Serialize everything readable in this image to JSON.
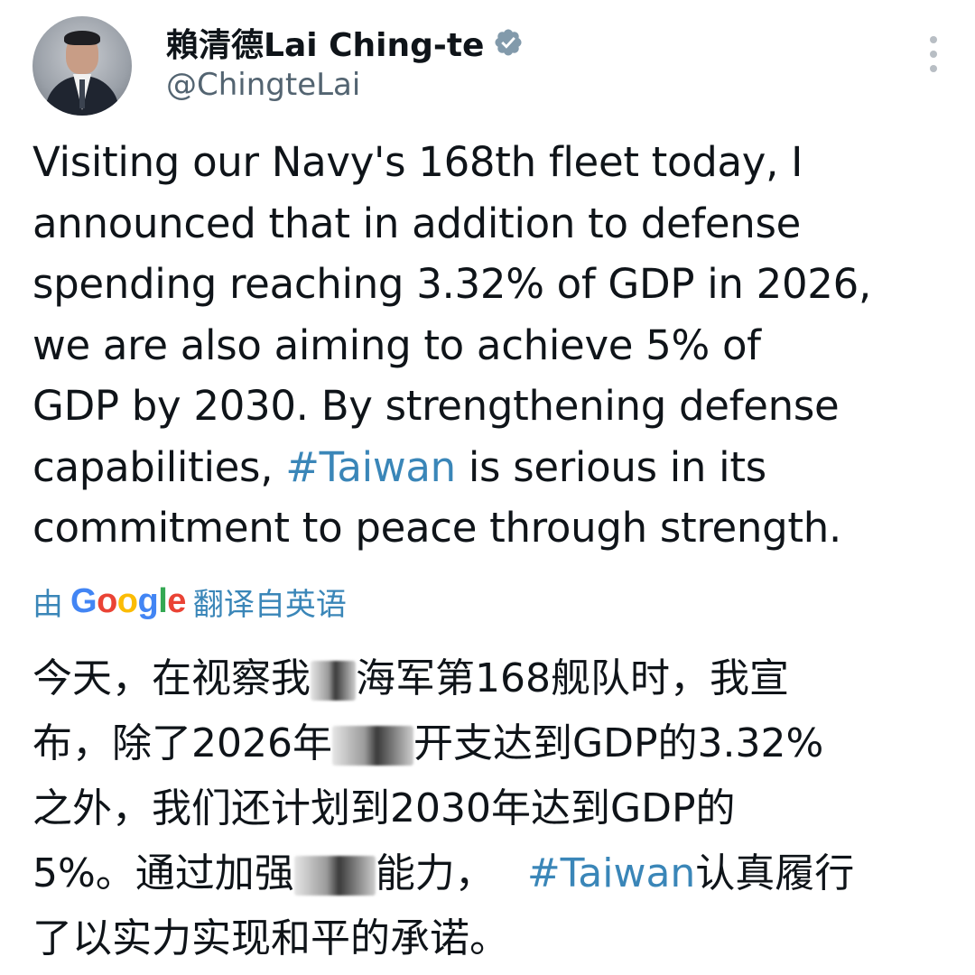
{
  "author": {
    "display_name": "賴清德Lai Ching-te",
    "handle": "@ChingteLai",
    "verified": true,
    "avatar_icon": "profile-photo"
  },
  "tweet": {
    "lines": [
      "Visiting our Navy's 168th fleet today, I",
      "announced that in addition to defense",
      "spending reaching 3.32% of GDP in 2026,",
      "we are also aiming to achieve 5% of",
      "GDP by 2030. By strengthening defense",
      "commitment to peace through strength."
    ],
    "line6_prefix": "capabilities, ",
    "hashtag": "#Taiwan",
    "line6_suffix": " is serious in its"
  },
  "translation": {
    "prefix": "由",
    "brand": "Google",
    "suffix": "翻译自英语",
    "line1_a": "今天，在视察我",
    "line1_b": "海军第168舰队时，我宣",
    "line2_a": "布，除了2026年",
    "line2_b": "开支达到GDP的3.32%",
    "line3": "之外，我们还计划到2030年达到GDP的",
    "line4_a": "5%。通过加强",
    "line4_b": "能力，",
    "line4_hashtag": "#Taiwan",
    "line4_c": "认真履行",
    "line5": "了以实力实现和平的承诺。"
  },
  "colors": {
    "text": "#0f1419",
    "secondary": "#536471",
    "link": "#3a86b8",
    "verified": "#829aab"
  }
}
